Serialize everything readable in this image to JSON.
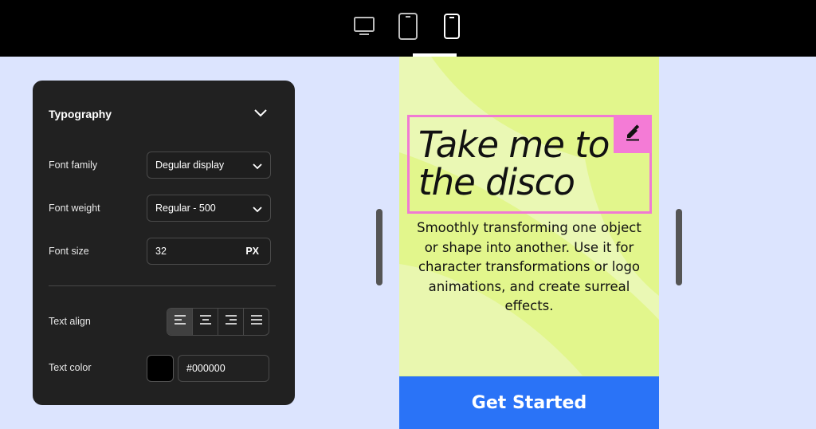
{
  "devices": {
    "items": [
      {
        "name": "desktop",
        "icon": "monitor-icon"
      },
      {
        "name": "tablet",
        "icon": "tablet-icon"
      },
      {
        "name": "mobile",
        "icon": "smartphone-icon",
        "active": true
      }
    ]
  },
  "panel": {
    "title": "Typography",
    "font_family": {
      "label": "Font family",
      "value": "Degular display"
    },
    "font_weight": {
      "label": "Font weight",
      "value": "Regular - 500"
    },
    "font_size": {
      "label": "Font size",
      "value": "32",
      "unit": "PX"
    },
    "text_align": {
      "label": "Text align",
      "selected": "left",
      "options": [
        "left",
        "center",
        "right",
        "justify"
      ]
    },
    "text_color": {
      "label": "Text color",
      "swatch": "#000000",
      "value": "#000000"
    }
  },
  "preview": {
    "headline_line1": "Take me to",
    "headline_line2": "the disco",
    "body": "Smoothly transforming one object or shape into another. Use it for character transformations or logo animations, and create surreal effects.",
    "cta": "Get Started",
    "colors": {
      "background": "#e2f68c",
      "highlight": "#f07ad3",
      "cta": "#2a73f7"
    }
  }
}
